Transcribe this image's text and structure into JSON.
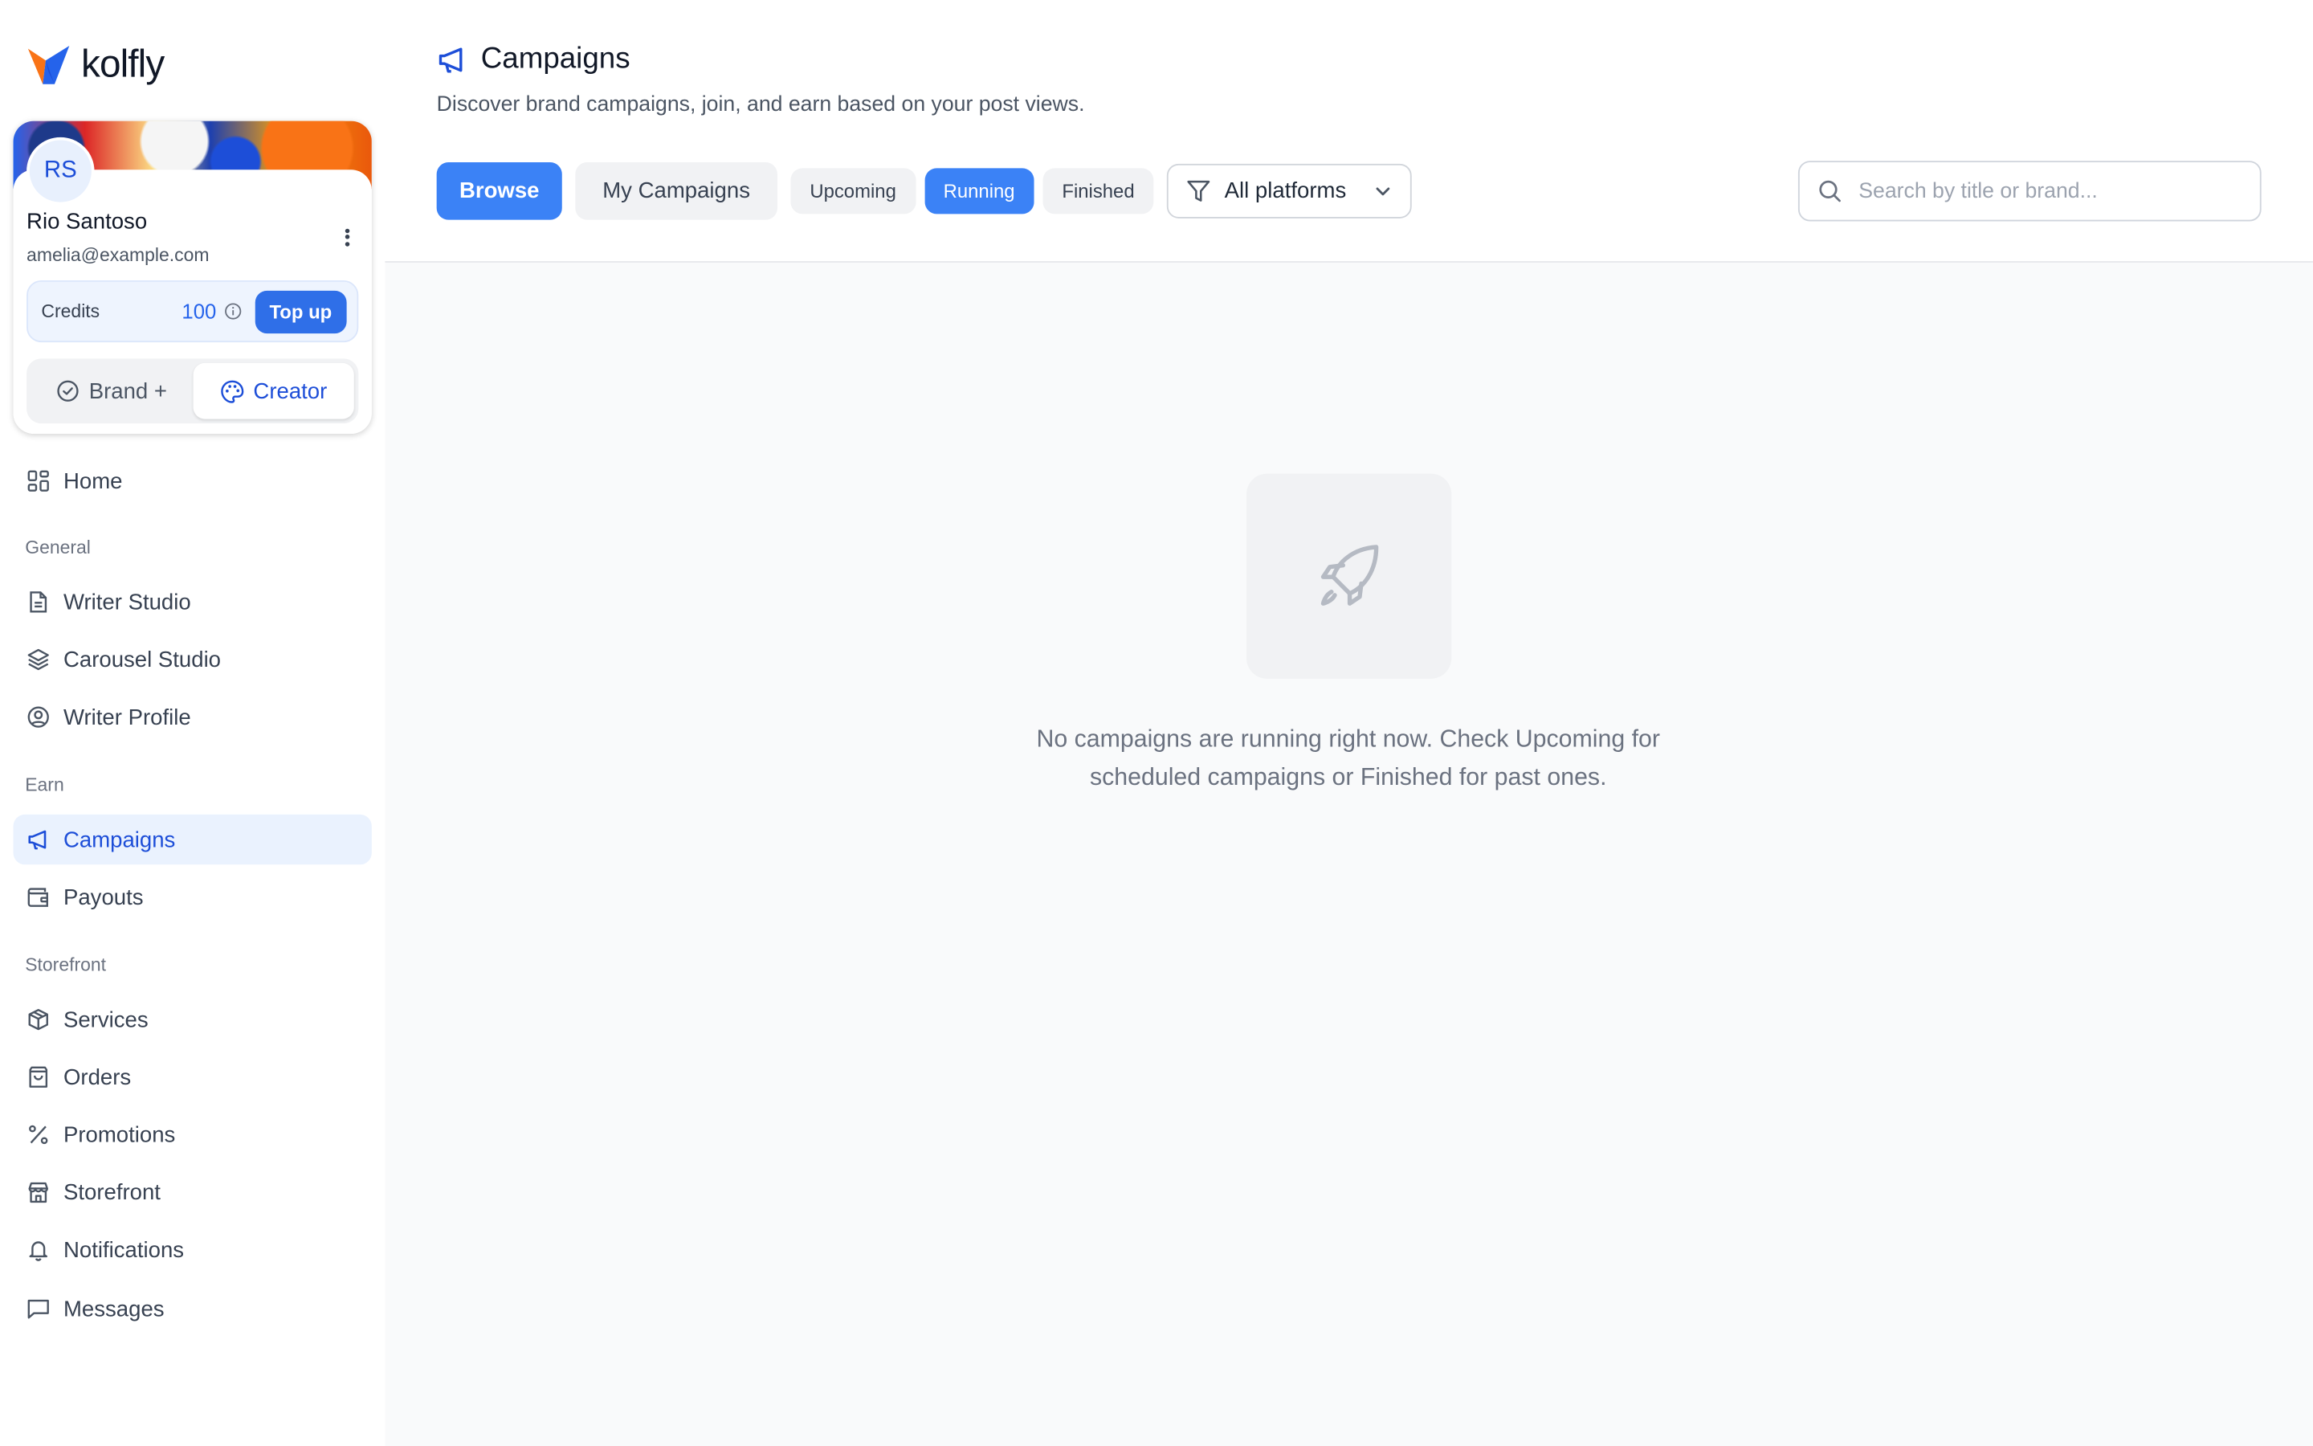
{
  "brand": {
    "name": "kolfly"
  },
  "profile": {
    "initials": "RS",
    "name": "Rio Santoso",
    "email": "amelia@example.com",
    "credits_label": "Credits",
    "credits_value": "100",
    "topup_label": "Top up",
    "roles": [
      {
        "label": "Brand +",
        "active": false
      },
      {
        "label": "Creator",
        "active": true
      }
    ]
  },
  "sidebar": {
    "home": {
      "label": "Home"
    },
    "sections": [
      {
        "title": "General",
        "items": [
          {
            "label": "Writer Studio",
            "icon": "file-text-icon"
          },
          {
            "label": "Carousel Studio",
            "icon": "layers-icon"
          },
          {
            "label": "Writer Profile",
            "icon": "user-circle-icon"
          }
        ]
      },
      {
        "title": "Earn",
        "items": [
          {
            "label": "Campaigns",
            "icon": "megaphone-icon",
            "active": true
          },
          {
            "label": "Payouts",
            "icon": "wallet-icon"
          }
        ]
      },
      {
        "title": "Storefront",
        "items": [
          {
            "label": "Services",
            "icon": "box-icon"
          },
          {
            "label": "Orders",
            "icon": "shopping-bag-icon"
          },
          {
            "label": "Promotions",
            "icon": "percent-icon"
          },
          {
            "label": "Storefront",
            "icon": "store-icon"
          },
          {
            "label": "Notifications",
            "icon": "bell-icon"
          },
          {
            "label": "Messages",
            "icon": "message-square-icon"
          }
        ]
      }
    ]
  },
  "page": {
    "title": "Campaigns",
    "subtitle": "Discover brand campaigns, join, and earn based on your post views."
  },
  "tabs": {
    "browse": "Browse",
    "my_campaigns": "My Campaigns",
    "filters": [
      {
        "label": "Upcoming",
        "active": false
      },
      {
        "label": "Running",
        "active": true
      },
      {
        "label": "Finished",
        "active": false
      }
    ],
    "platform_select": "All platforms"
  },
  "search": {
    "placeholder": "Search by title or brand...",
    "value": ""
  },
  "empty_state": {
    "line1": "No campaigns are running right now. Check Upcoming for",
    "line2": "scheduled campaigns or Finished for past ones."
  },
  "colors": {
    "accent": "#3b82f6",
    "accent_dark": "#1d4ed8",
    "active_nav_bg": "#eaf2fe"
  }
}
